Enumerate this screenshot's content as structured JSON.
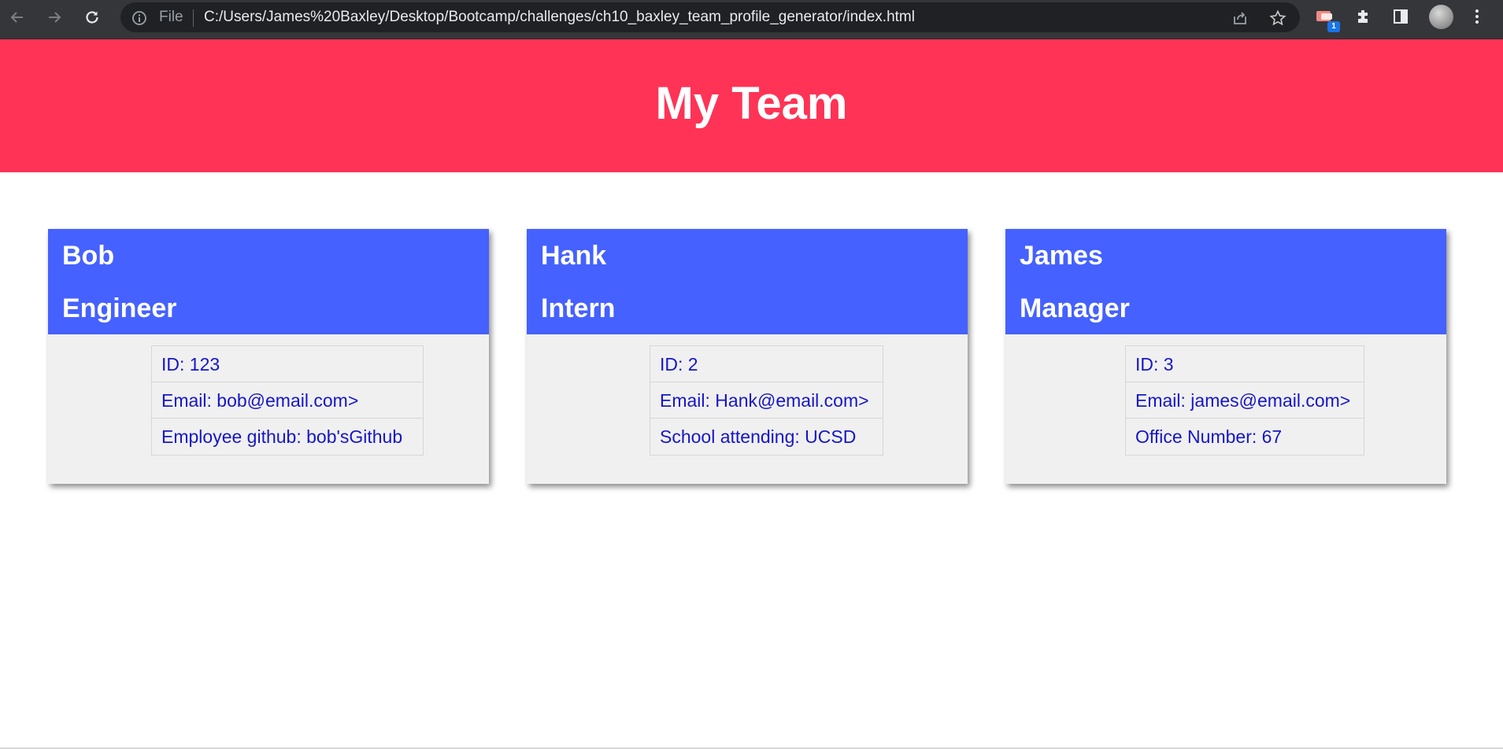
{
  "browser": {
    "scheme_label": "File",
    "url": "C:/Users/James%20Baxley/Desktop/Bootcamp/challenges/ch10_baxley_team_profile_generator/index.html",
    "extension_badge": "1",
    "icons": [
      "back-icon",
      "forward-icon",
      "reload-icon",
      "info-icon",
      "share-icon",
      "star-icon",
      "extension-icon",
      "puzzle-icon",
      "side-panel-icon",
      "profile-avatar",
      "more-icon"
    ]
  },
  "header": {
    "title": "My Team",
    "background": "#ff3355"
  },
  "colors": {
    "card_header": "#4561ff",
    "card_body": "#f0f0f0",
    "info_text": "#1616c8"
  },
  "cards": [
    {
      "name": "Bob",
      "role": "Engineer",
      "items": [
        "ID: 123",
        "Email: bob@email.com>",
        "Employee github: bob'sGithub"
      ]
    },
    {
      "name": "Hank",
      "role": "Intern",
      "items": [
        "ID: 2",
        "Email: Hank@email.com>",
        "School attending: UCSD"
      ]
    },
    {
      "name": "James",
      "role": "Manager",
      "items": [
        "ID: 3",
        "Email: james@email.com>",
        "Office Number: 67"
      ]
    }
  ]
}
